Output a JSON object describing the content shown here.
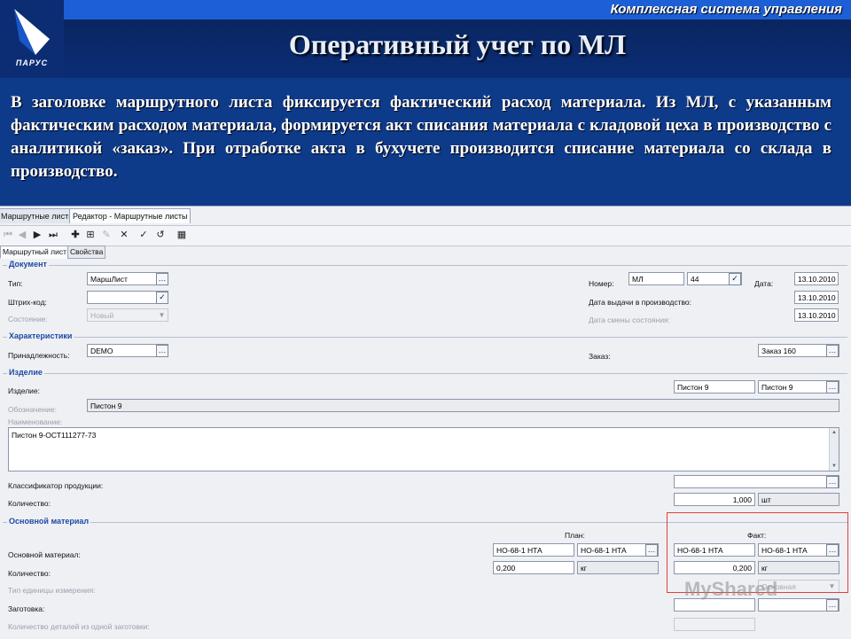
{
  "slide": {
    "system_name": "Комплексная система управления",
    "logo_text": "ПАРУС",
    "title": "Оперативный учет по МЛ",
    "description": "В заголовке маршрутного листа фиксируется фактический расход материала. Из МЛ, с указанным фактическим расходом материала, формируется акт списания материала с кладовой цеха в производство с аналитикой «заказ». При отработке акта в бухучете производится списание материала со склада в производство."
  },
  "app": {
    "doc_tabs": [
      "Маршрутные листы",
      "Редактор - Маршрутные листы"
    ],
    "form_tabs": [
      "Маршрутный лист",
      "Свойства"
    ],
    "toolbar_icons": [
      "first-icon",
      "prev-icon",
      "next-icon",
      "last-icon",
      "add-icon",
      "add-copy-icon",
      "edit-icon",
      "delete-icon",
      "apply-icon",
      "refresh-icon",
      "calendar-icon"
    ],
    "groups": {
      "document": "Документ",
      "characteristics": "Характеристики",
      "product": "Изделие",
      "material": "Основной материал"
    },
    "document": {
      "type_label": "Тип:",
      "type_value": "МаршЛист",
      "barcode_label": "Штрих-код:",
      "barcode_value": "",
      "state_label": "Состояние:",
      "state_value": "Новый",
      "number_label": "Номер:",
      "number_prefix": "МЛ",
      "number_value": "44",
      "date_label": "Дата:",
      "date_value": "13.10.2010",
      "issue_date_label": "Дата выдачи в производство:",
      "issue_date_value": "13.10.2010",
      "state_change_label": "Дата смены состояния:",
      "state_change_value": "13.10.2010"
    },
    "characteristics": {
      "owner_label": "Принадлежность:",
      "owner_value": "DEMO",
      "order_label": "Заказ:",
      "order_value": "Заказ 160"
    },
    "product": {
      "item_label": "Изделие:",
      "item_value1": "Пистон 9",
      "item_value2": "Пистон 9",
      "designation_label": "Обозначение:",
      "designation_value": "Пистон 9",
      "name_label": "Наименование:",
      "name_value": "Пистон 9-ОСТ111277-73",
      "classifier_label": "Классификатор продукции:",
      "classifier_value": "",
      "qty_label": "Количество:",
      "qty_value": "1,000",
      "qty_unit": "шт"
    },
    "material": {
      "plan_header": "План:",
      "fact_header": "Факт:",
      "main_label": "Основной материал:",
      "plan_mat1": "НО-68-1 НТА",
      "plan_mat2": "НО-68-1 НТА",
      "fact_mat1": "НО-68-1 НТА",
      "fact_mat2": "НО-68-1 НТА",
      "qty_label": "Количество:",
      "plan_qty": "0,200",
      "plan_unit": "кг",
      "fact_qty": "0,200",
      "fact_unit": "кг",
      "unit_type_label": "Тип единицы измерения:",
      "unit_type_value": "Основная",
      "blank_label": "Заготовка:",
      "parts_label": "Количество деталей из одной заготовки:"
    },
    "watermark": "MyShared"
  }
}
